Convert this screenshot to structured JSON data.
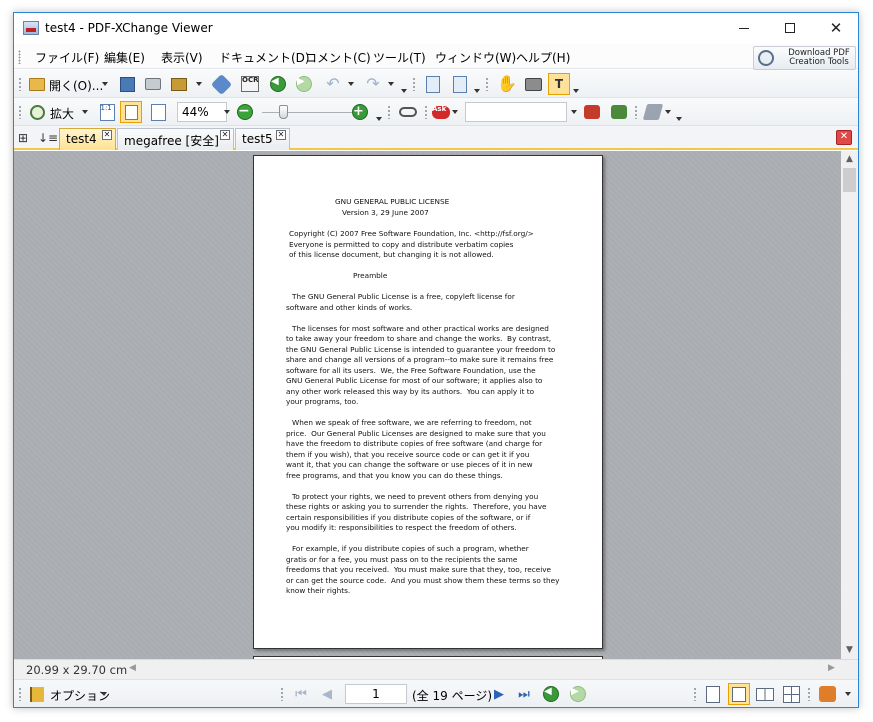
{
  "window": {
    "title": "test4 - PDF-XChange Viewer",
    "controls": {
      "minimize": "minimize",
      "maximize": "maximize",
      "close": "✕"
    }
  },
  "menu": {
    "items": [
      "ファイル(F)",
      "編集(E)",
      "表示(V)",
      "ドキュメント(D)",
      "コメント(C)",
      "ツール(T)",
      "ウィンドウ(W)",
      "ヘルプ(H)"
    ],
    "download_label_1": "Download PDF",
    "download_label_2": "Creation Tools"
  },
  "toolbar1": {
    "open_label": "開く(O)...",
    "ocr_label": "OCR"
  },
  "toolbar2": {
    "zoom_label": "拡大",
    "fit_label": "1:1",
    "zoom_value": "44%",
    "search_value": ""
  },
  "tabs": [
    {
      "label": "test4",
      "active": true
    },
    {
      "label": "megafree [安全]",
      "active": false
    },
    {
      "label": "test5",
      "active": false
    }
  ],
  "document": {
    "lines": [
      "GNU GENERAL PUBLIC LICENSE",
      "Version 3, 29 June 2007",
      "Copyright (C) 2007 Free Software Foundation, Inc. <http://fsf.org/>",
      "Everyone is permitted to copy and distribute verbatim copies",
      "of this license document, but changing it is not allowed.",
      "Preamble",
      "The GNU General Public License is a free, copyleft license for",
      "software and other kinds of works.",
      "The licenses for most software and other practical works are designed",
      "to take away your freedom to share and change the works.  By contrast,",
      "the GNU General Public License is intended to guarantee your freedom to",
      "share and change all versions of a program--to make sure it remains free",
      "software for all its users.  We, the Free Software Foundation, use the",
      "GNU General Public License for most of our software; it applies also to",
      "any other work released this way by its authors.  You can apply it to",
      "your programs, too.",
      "When we speak of free software, we are referring to freedom, not",
      "price.  Our General Public Licenses are designed to make sure that you",
      "have the freedom to distribute copies of free software (and charge for",
      "them if you wish), that you receive source code or can get it if you",
      "want it, that you can change the software or use pieces of it in new",
      "free programs, and that you know you can do these things.",
      "To protect your rights, we need to prevent others from denying you",
      "these rights or asking you to surrender the rights.  Therefore, you have",
      "certain responsibilities if you distribute copies of the software, or if",
      "you modify it: responsibilities to respect the freedom of others.",
      "For example, if you distribute copies of such a program, whether",
      "gratis or for a fee, you must pass on to the recipients the same",
      "freedoms that you received.  You must make sure that they, too, receive",
      "or can get the source code.  And you must show them these terms so they",
      "know their rights."
    ]
  },
  "status": {
    "page_size": "20.99 x 29.70 cm"
  },
  "navbar": {
    "options_label": "オプション",
    "current_page": "1",
    "total_pages_label": "(全 19 ページ)"
  },
  "colors": {
    "tab_accent": "#f2c84b",
    "doc_background": "#a9acb0",
    "window_border": "#2b86d8"
  }
}
